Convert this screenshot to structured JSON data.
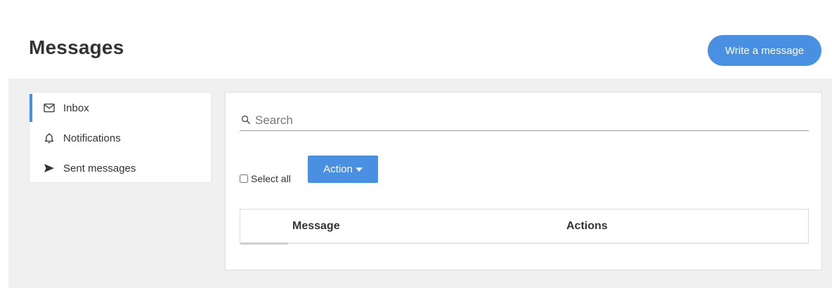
{
  "header": {
    "title": "Messages",
    "write_button_label": "Write a message"
  },
  "sidebar": {
    "items": [
      {
        "label": "Inbox",
        "icon": "envelope-icon",
        "active": true
      },
      {
        "label": "Notifications",
        "icon": "bell-icon",
        "active": false
      },
      {
        "label": "Sent messages",
        "icon": "send-icon",
        "active": false
      }
    ]
  },
  "search": {
    "placeholder": "Search",
    "value": ""
  },
  "toolbar": {
    "select_all_label": "Select all",
    "action_label": "Action"
  },
  "table": {
    "columns": [
      "Message",
      "Actions"
    ],
    "rows": []
  },
  "colors": {
    "accent": "#4a90e2",
    "background": "#f0f0f0"
  }
}
